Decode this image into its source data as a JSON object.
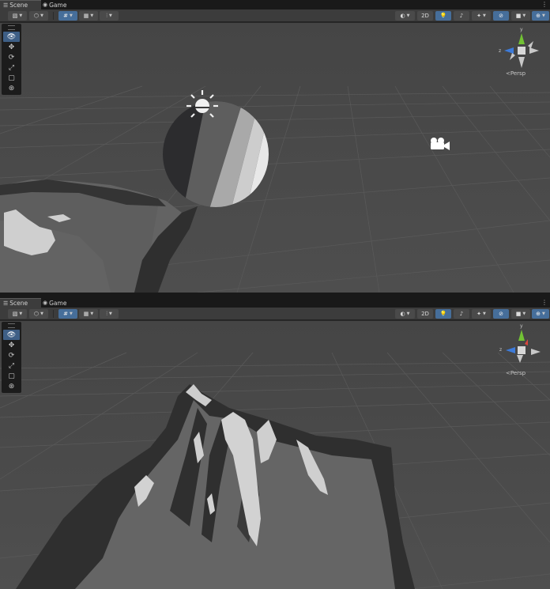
{
  "panels": [
    {
      "tabs": {
        "scene": "Scene",
        "game": "Game"
      },
      "toolbar": {
        "toggle_2d": "2D"
      },
      "gizmo": {
        "projection": "Persp",
        "axis_x": "x",
        "axis_y": "y",
        "axis_z": "z"
      }
    },
    {
      "tabs": {
        "scene": "Scene",
        "game": "Game"
      },
      "toolbar": {
        "toggle_2d": "2D"
      },
      "gizmo": {
        "projection": "Persp",
        "axis_x": "x",
        "axis_y": "y",
        "axis_z": "z"
      }
    }
  ],
  "tools": [
    "view-tool",
    "move-tool",
    "rotate-tool",
    "scale-tool",
    "rect-tool",
    "transform-tool"
  ],
  "colors": {
    "accent": "#466e9a",
    "viewport_bg": "#484848",
    "tab_bg": "#191919",
    "toolbar_bg": "#3c3c3c"
  }
}
